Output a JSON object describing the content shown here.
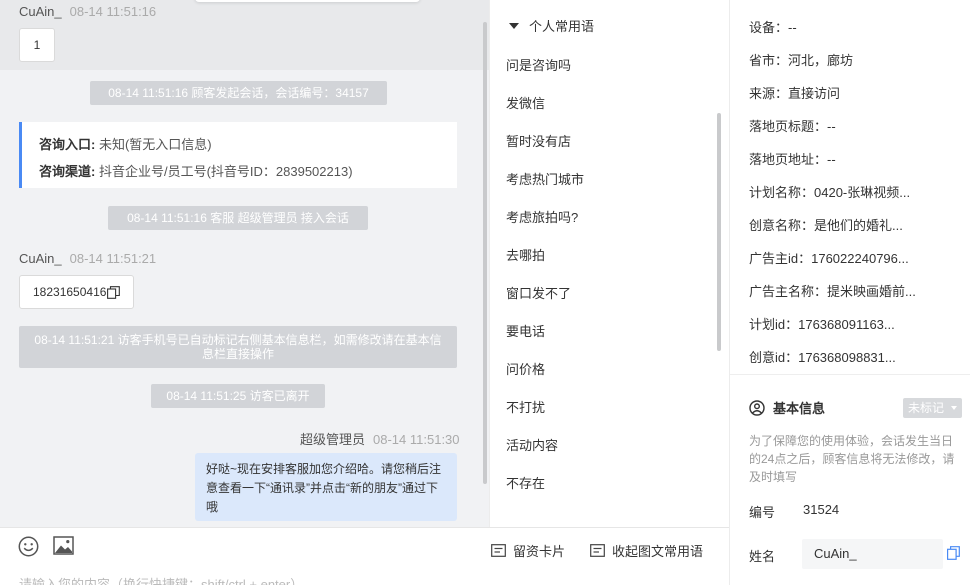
{
  "chat": {
    "msg1": {
      "sender": "CuAin_",
      "time": "08-14 11:51:16",
      "text": "1"
    },
    "sys_start": "08-14 11:51:16 顾客发起会话，会话编号：34157",
    "entry_card": {
      "entry_label": "咨询入口:",
      "entry_value": "未知(暂无入口信息)",
      "channel_label": "咨询渠道:",
      "channel_value": "抖音企业号/员工号(抖音号ID：2839502213)"
    },
    "sys_join": "08-14 11:51:16 客服 超级管理员 接入会话",
    "msg2": {
      "sender": "CuAin_",
      "time": "08-14 11:51:21",
      "text": "18231650416"
    },
    "sys_phone": "08-14 11:51:21 访客手机号已自动标记右侧基本信息栏，如需修改请在基本信息栏直接操作",
    "sys_leave": "08-14 11:51:25 访客已离开",
    "agent_msg": {
      "sender": "超级管理员",
      "time": "08-14 11:51:30",
      "text": "好哒~现在安排客服加您介绍哈。请您稍后注意查看一下“通讯录”并点击“新的朋友”通过下哦"
    }
  },
  "input": {
    "placeholder": "请输入您的内容（换行快捷键：shift/ctrl + enter）",
    "leave_card": "留资卡片",
    "collapse_phrases": "收起图文常用语",
    "icons": [
      "emoji-icon",
      "image-icon",
      "card-icon",
      "phrases-icon"
    ]
  },
  "phrases": {
    "group_title": "个人常用语",
    "items": [
      "问是咨询吗",
      "发微信",
      "暂时没有店",
      "考虑热门城市",
      "考虑旅拍吗?",
      "去哪拍",
      "窗口发不了",
      "要电话",
      "问价格",
      "不打扰",
      "活动内容",
      "不存在"
    ]
  },
  "info": {
    "rows": [
      "设备：--",
      "省市：河北，廊坊",
      "来源：直接访问",
      "落地页标题：--",
      "落地页地址：--",
      "计划名称：0420-张琳视频...",
      "创意名称：是他们的婚礼...",
      "广告主id：176022240796...",
      "广告主名称：提米映画婚前...",
      "计划id：176368091163...",
      "创意id：176368098831..."
    ],
    "basic_title": "基本信息",
    "tag": "未标记",
    "notice": "为了保障您的使用体验，会话发生当日的24点之后，顾客信息将无法修改，请及时填写",
    "number_label": "编号",
    "number_value": "31524",
    "name_label": "姓名",
    "name_value": "CuAin_"
  },
  "colors": {
    "accent": "#4a8af4",
    "system_pill": "#d2d4d8",
    "agent_bubble": "#dbe8fb",
    "chat_bg": "#f1f2f4"
  }
}
